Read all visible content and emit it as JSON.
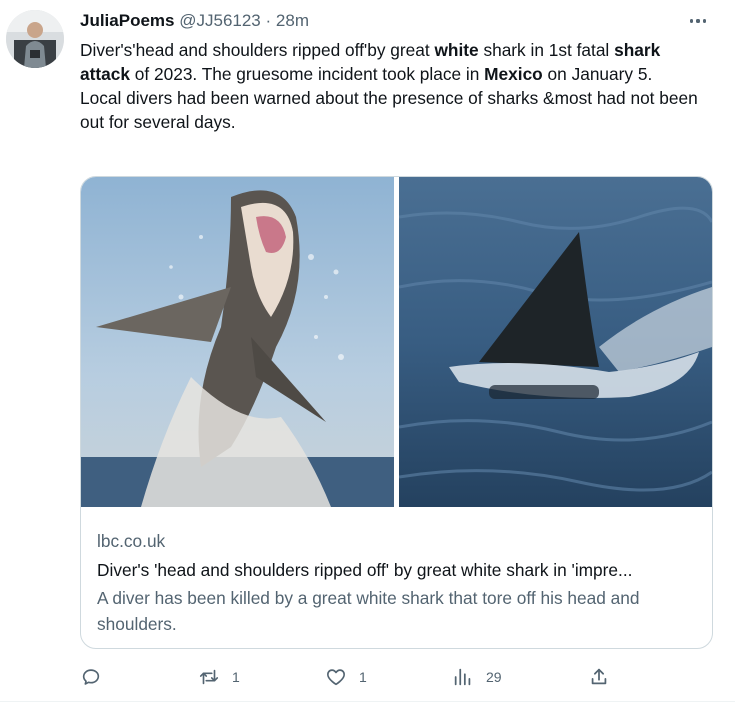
{
  "user": {
    "display_name": "JuliaPoems",
    "handle": "@JJ56123",
    "separator": "·",
    "time": "28m"
  },
  "tweet": {
    "p1": [
      {
        "text": "Diver's'head and shoulders ripped off'by great ",
        "bold": false
      },
      {
        "text": "white",
        "bold": true
      },
      {
        "text": " shark in 1st fatal ",
        "bold": false
      },
      {
        "text": "shark attack",
        "bold": true
      },
      {
        "text": " of 2023. The gruesome incident took place in ",
        "bold": false
      },
      {
        "text": "Mexico",
        "bold": true
      },
      {
        "text": " on January 5.",
        "bold": false
      }
    ],
    "p2": "Local divers had been warned about the presence of sharks &most had not been out for several days."
  },
  "card": {
    "domain": "lbc.co.uk",
    "title": "Diver's 'head and shoulders ripped off' by great white shark in 'impre...",
    "description": "A diver has been killed by a great white shark that tore off his head and shoulders."
  },
  "actions": {
    "reply": {
      "icon": "reply-icon",
      "count": ""
    },
    "retweet": {
      "icon": "retweet-icon",
      "count": "1"
    },
    "like": {
      "icon": "heart-icon",
      "count": "1"
    },
    "views": {
      "icon": "views-chart-icon",
      "count": "29"
    },
    "share": {
      "icon": "share-icon"
    }
  },
  "colors": {
    "text": "#0f1419",
    "secondary": "#536471",
    "border": "#cfd9de"
  }
}
